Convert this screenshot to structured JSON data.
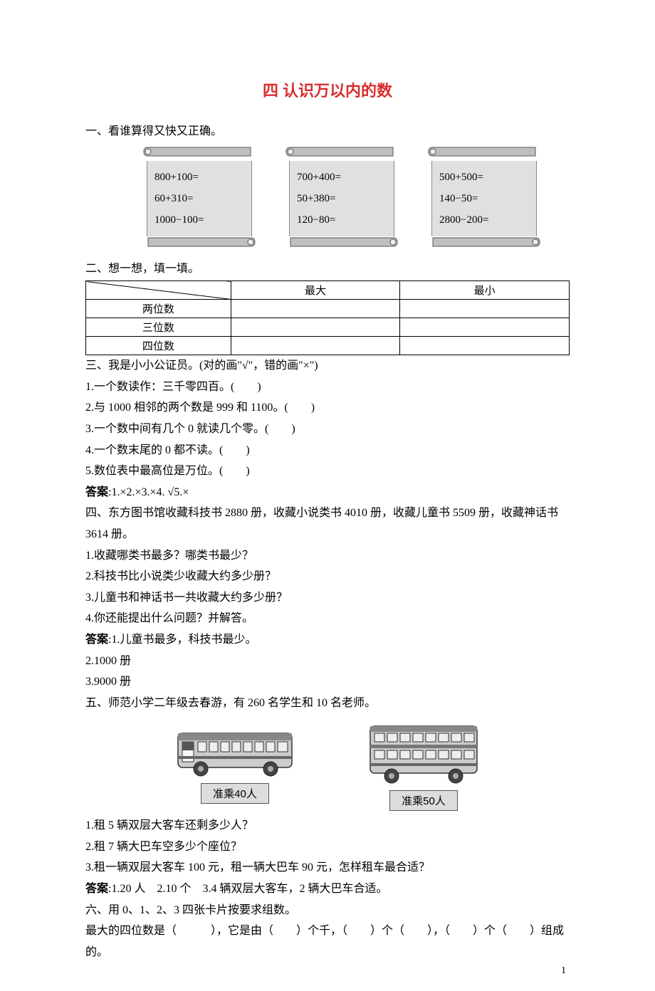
{
  "title": "四 认识万以内的数",
  "s1": {
    "heading": "一、看谁算得又快又正确。",
    "col1": [
      "800+100=",
      "60+310=",
      "1000−100="
    ],
    "col2": [
      "700+400=",
      "50+380=",
      "120−80="
    ],
    "col3": [
      "500+500=",
      "140−50=",
      "2800−200="
    ]
  },
  "s2": {
    "heading": "二、想一想，填一填。",
    "headers": {
      "max": "最大",
      "min": "最小"
    },
    "rows": [
      "两位数",
      "三位数",
      "四位数"
    ]
  },
  "s3": {
    "heading": "三、我是小小公证员。(对的画\"√\"，错的画\"×\")",
    "items": [
      "1.一个数读作：三千零四百。(　　)",
      "2.与 1000 相邻的两个数是 999 和 1100。(　　)",
      "3.一个数中间有几个 0 就读几个零。(　　)",
      "4.一个数末尾的 0 都不读。(　　)",
      "5.数位表中最高位是万位。(　　)"
    ],
    "answer_label": "答案",
    "answer": ":1.×2.×3.×4. √5.×"
  },
  "s4": {
    "intro": "四、东方图书馆收藏科技书 2880 册，收藏小说类书 4010 册，收藏儿童书 5509 册，收藏神话书 3614 册。",
    "q": [
      "1.收藏哪类书最多？哪类书最少？",
      "2.科技书比小说类少收藏大约多少册？",
      "3.儿童书和神话书一共收藏大约多少册？",
      "4.你还能提出什么问题？并解答。"
    ],
    "answer_label": "答案",
    "a1": ":1.儿童书最多，科技书最少。",
    "a2": "2.1000 册",
    "a3": "3.9000 册"
  },
  "s5": {
    "intro": "五、师范小学二年级去春游，有 260 名学生和 10 名老师。",
    "bus1_label": "准乘40人",
    "bus2_label": "准乘50人",
    "q": [
      "1.租 5 辆双层大客车还剩多少人？",
      "2.租 7 辆大巴车空多少个座位？",
      "3.租一辆双层大客车 100 元，租一辆大巴车 90 元，怎样租车最合适？"
    ],
    "answer_label": "答案",
    "answer": ":1.20 人　2.10 个　3.4 辆双层大客车，2 辆大巴车合适。"
  },
  "s6": {
    "heading": "六、用 0、1、2、3 四张卡片按要求组数。",
    "line": "最大的四位数是（　　　），它是由（　　）个千，（　　）个（　　），（　　）个（　　）组成的。"
  },
  "page_number": "1"
}
